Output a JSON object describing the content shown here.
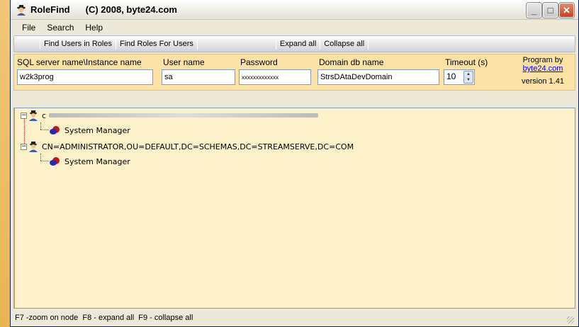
{
  "window": {
    "app_name": "RoleFind",
    "copyright": "(C) 2008, byte24.com",
    "minimize": "_",
    "maximize": "□",
    "close": "✕"
  },
  "menu": [
    {
      "label": "File"
    },
    {
      "label": "Search"
    },
    {
      "label": "Help"
    }
  ],
  "toolbar": {
    "find_users": "Find Users in Roles",
    "find_roles": "Find Roles For Users",
    "expand_all": "Expand all",
    "collapse_all": "Collapse all"
  },
  "params": {
    "server_label": "SQL server name\\Instance name",
    "server_value": "w2k3prog",
    "user_label": "User name",
    "user_value": "sa",
    "password_label": "Password",
    "password_value": "xxxxxxxxxxxxx",
    "domain_label": "Domain db name",
    "domain_value": "StrsDAtaDevDomain",
    "timeout_label": "Timeout (s)",
    "timeout_value": "10"
  },
  "about": {
    "program_by": "Program by",
    "link": "byte24.com",
    "version": "version 1.41"
  },
  "tree": [
    {
      "label": "c",
      "children": [
        {
          "label": "System Manager"
        }
      ]
    },
    {
      "label": "CN=ADMINISTRATOR,OU=DEFAULT,DC=SCHEMAS,DC=STREAMSERVE,DC=COM",
      "children": [
        {
          "label": "System Manager"
        }
      ]
    }
  ],
  "status": "F7 -zoom on node  F8 - expand all  F9 - collapse all",
  "colors": {
    "params_bg": "#fde2a8",
    "tree_bg": "#fdf1c9",
    "link": "#0000ee"
  }
}
